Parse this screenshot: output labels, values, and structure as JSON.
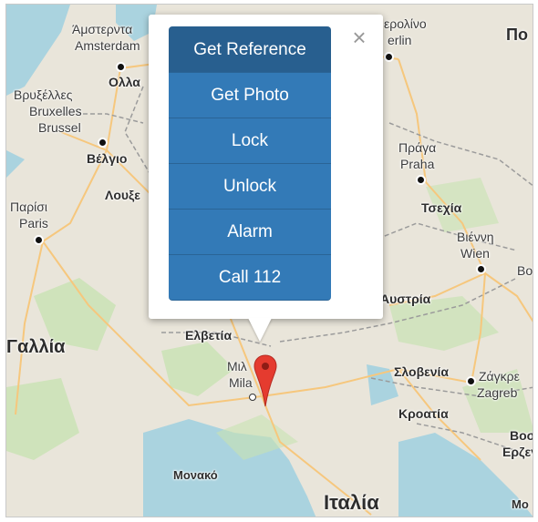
{
  "map": {
    "colors": {
      "land": "#e9e5da",
      "water": "#aad3df",
      "park": "#c8e2b3",
      "road": "#f6c77d",
      "border": "#9b9b9b"
    },
    "labels": [
      {
        "key": "amsterdam_gr",
        "text": "Άμστερντα"
      },
      {
        "key": "amsterdam",
        "text": "Amsterdam"
      },
      {
        "key": "ollandia",
        "text": "Ολλα"
      },
      {
        "key": "brussels_gr",
        "text": "Βρυξέλλες"
      },
      {
        "key": "brussels_fr",
        "text": "Bruxelles"
      },
      {
        "key": "brussels_nl",
        "text": "Brussel"
      },
      {
        "key": "belgio",
        "text": "Βέλγιο"
      },
      {
        "key": "luxemburg",
        "text": "Λουξε"
      },
      {
        "key": "paris_gr",
        "text": "Παρίσι"
      },
      {
        "key": "paris",
        "text": "Paris"
      },
      {
        "key": "gallia",
        "text": "Γαλλία"
      },
      {
        "key": "verolino",
        "text": "ερολίνο"
      },
      {
        "key": "berlin",
        "text": "erlin"
      },
      {
        "key": "po",
        "text": "Πο"
      },
      {
        "key": "praga_gr",
        "text": "Πράγα"
      },
      {
        "key": "praha",
        "text": "Praha"
      },
      {
        "key": "tsexia",
        "text": "Τσεχία"
      },
      {
        "key": "vienna_gr",
        "text": "Βιέννη"
      },
      {
        "key": "wien",
        "text": "Wien"
      },
      {
        "key": "bo",
        "text": "Bo"
      },
      {
        "key": "austria",
        "text": "Αυστρία"
      },
      {
        "key": "elvetia",
        "text": "Ελβετία"
      },
      {
        "key": "milano_gr",
        "text": "Μιλ"
      },
      {
        "key": "milano",
        "text": "Mila"
      },
      {
        "key": "slovenia",
        "text": "Σλοβενία"
      },
      {
        "key": "zagreb_gr",
        "text": "Ζάγκρε"
      },
      {
        "key": "zagreb",
        "text": "Zagreb"
      },
      {
        "key": "kroatia",
        "text": "Κροατία"
      },
      {
        "key": "bosnia",
        "text": "Βοσ"
      },
      {
        "key": "erzego",
        "text": "Ερζεγο"
      },
      {
        "key": "monako",
        "text": "Μονακό"
      },
      {
        "key": "italia",
        "text": "Ιταλία"
      },
      {
        "key": "mo",
        "text": "Μο"
      }
    ]
  },
  "popup": {
    "close_glyph": "×",
    "buttons": [
      {
        "label": "Get Reference"
      },
      {
        "label": "Get Photo"
      },
      {
        "label": "Lock"
      },
      {
        "label": "Unlock"
      },
      {
        "label": "Alarm"
      },
      {
        "label": "Call 112"
      }
    ]
  },
  "marker": {
    "icon": "map-pin-icon",
    "color": "#e53b2f"
  }
}
